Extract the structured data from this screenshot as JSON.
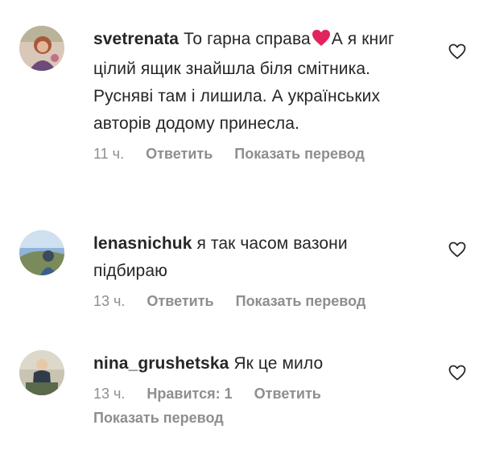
{
  "comments": [
    {
      "username": "svetrenata",
      "text_before_emoji": "То гарна справа",
      "emoji": "red-heart",
      "text_after_emoji": "А я книг цілий ящик знайшла біля смітника. Руснявi там і лишила. А українських авторів додому принесла.",
      "time": "11 ч.",
      "reply_label": "Ответить",
      "translate_label": "Показать перевод",
      "like_icon": "heart-outline-icon"
    },
    {
      "username": "lenasnichuk",
      "text": "я так часом вазони підбираю",
      "time": "13 ч.",
      "reply_label": "Ответить",
      "translate_label": "Показать перевод",
      "like_icon": "heart-outline-icon"
    },
    {
      "username": "nina_grushetska",
      "text": "Як це мило",
      "time": "13 ч.",
      "likes_label": "Нравится: 1",
      "reply_label": "Ответить",
      "translate_label": "Показать перевод",
      "like_icon": "heart-outline-icon"
    }
  ],
  "colors": {
    "text": "#262626",
    "meta": "#8e8e8e",
    "heart_emoji": "#e0245e"
  }
}
